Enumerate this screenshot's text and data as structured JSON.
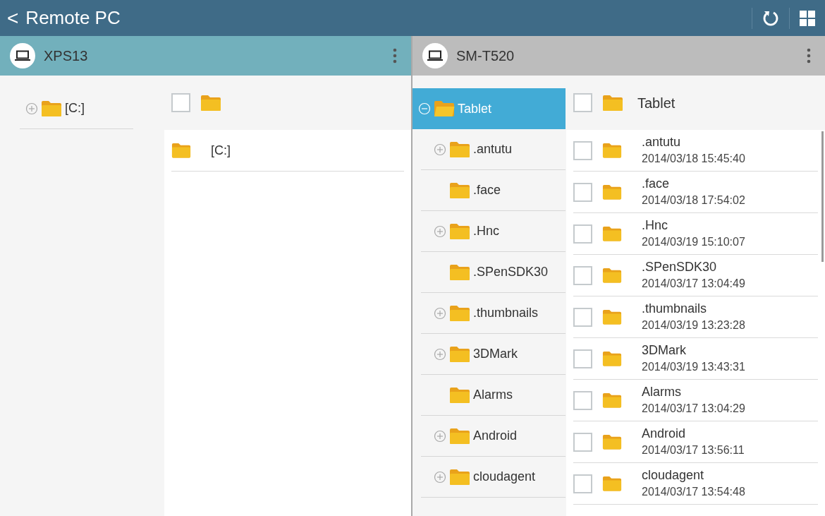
{
  "app_bar": {
    "back": "<",
    "title": "Remote PC"
  },
  "panes": [
    {
      "device": "XPS13",
      "selected": true,
      "tree": [
        {
          "label": "[C:]",
          "kind": "collapsed",
          "selected": false
        }
      ],
      "header": {
        "checked": false
      },
      "files": [
        {
          "name": "[C:]"
        }
      ]
    },
    {
      "device": "SM-T520",
      "selected": false,
      "tree": [
        {
          "label": "Tablet",
          "kind": "expanded",
          "selected": true,
          "children": [
            {
              "label": ".antutu",
              "kind": "collapsed",
              "selected": false
            },
            {
              "label": ".face",
              "kind": "leaf",
              "selected": false
            },
            {
              "label": ".Hnc",
              "kind": "collapsed",
              "selected": false
            },
            {
              "label": ".SPenSDK30",
              "kind": "leaf",
              "selected": false
            },
            {
              "label": ".thumbnails",
              "kind": "collapsed",
              "selected": false
            },
            {
              "label": "3DMark",
              "kind": "collapsed",
              "selected": false
            },
            {
              "label": "Alarms",
              "kind": "leaf",
              "selected": false
            },
            {
              "label": "Android",
              "kind": "collapsed",
              "selected": false
            },
            {
              "label": "cloudagent",
              "kind": "collapsed",
              "selected": false
            }
          ]
        }
      ],
      "header": {
        "label": "Tablet",
        "checked": false
      },
      "files": [
        {
          "name": ".antutu",
          "date": "2014/03/18 15:45:40",
          "checked": false
        },
        {
          "name": ".face",
          "date": "2014/03/18 17:54:02",
          "checked": false
        },
        {
          "name": ".Hnc",
          "date": "2014/03/19 15:10:07",
          "checked": false
        },
        {
          "name": ".SPenSDK30",
          "date": "2014/03/17 13:04:49",
          "checked": false
        },
        {
          "name": ".thumbnails",
          "date": "2014/03/19 13:23:28",
          "checked": false
        },
        {
          "name": "3DMark",
          "date": "2014/03/19 13:43:31",
          "checked": false
        },
        {
          "name": "Alarms",
          "date": "2014/03/17 13:04:29",
          "checked": false
        },
        {
          "name": "Android",
          "date": "2014/03/17 13:56:11",
          "checked": false
        },
        {
          "name": "cloudagent",
          "date": "2014/03/17 13:54:48",
          "checked": false
        }
      ]
    }
  ]
}
